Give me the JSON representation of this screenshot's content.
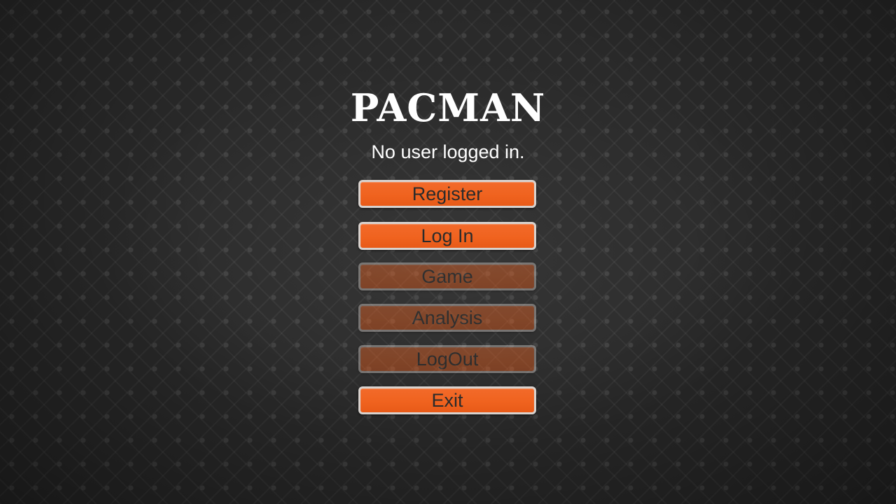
{
  "title": "PACMAN",
  "status": "No user logged in.",
  "menu": {
    "register": "Register",
    "login": "Log In",
    "game": "Game",
    "analysis": "Analysis",
    "logout": "LogOut",
    "exit": "Exit"
  },
  "states": {
    "register": "enabled",
    "login": "enabled",
    "game": "disabled",
    "analysis": "disabled",
    "logout": "disabled",
    "exit": "enabled"
  },
  "colors": {
    "button": "#f0631f",
    "button_border": "#d8d2ce",
    "button_text": "#2b2b2b",
    "background": "#2a2a2a",
    "title": "#ffffff"
  }
}
